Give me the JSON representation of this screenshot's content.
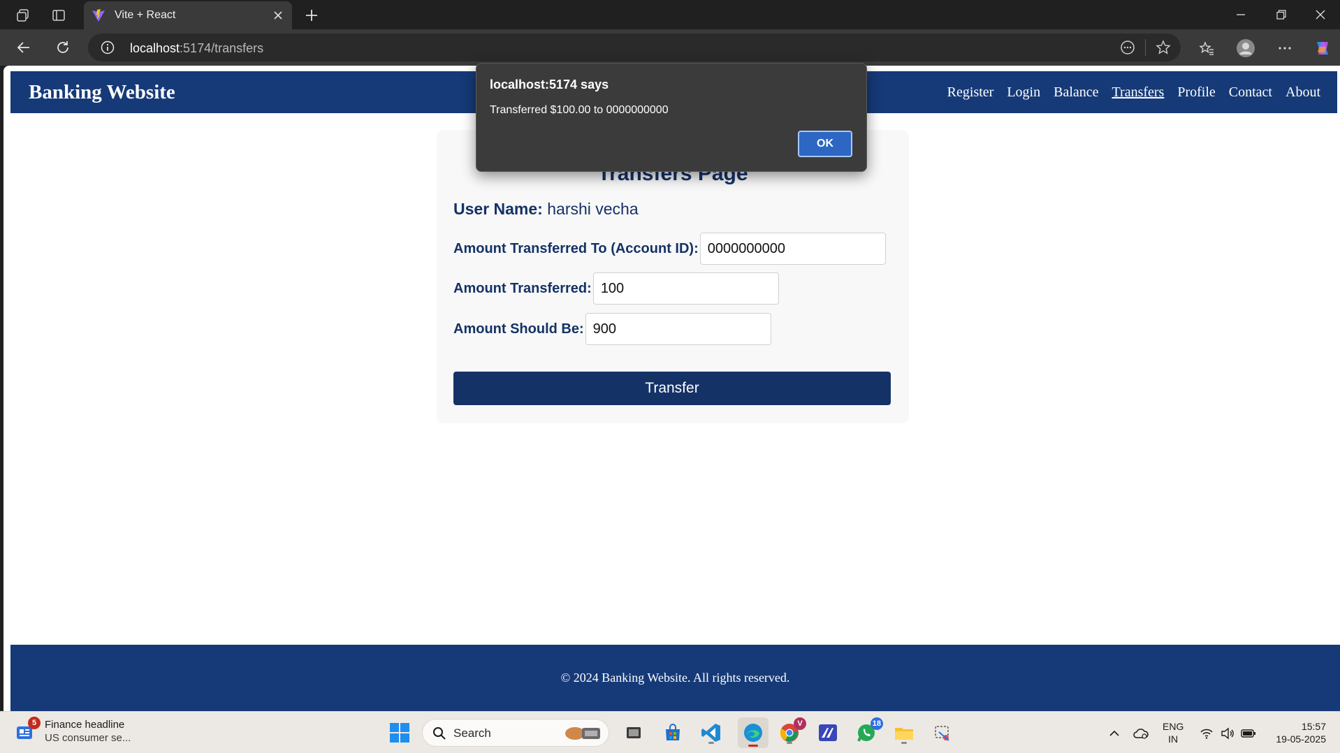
{
  "browser": {
    "tab_title": "Vite + React",
    "url_host": "localhost",
    "url_path": ":5174/transfers"
  },
  "site": {
    "title": "Banking Website",
    "nav": [
      {
        "label": "Register"
      },
      {
        "label": "Login"
      },
      {
        "label": "Balance"
      },
      {
        "label": "Transfers",
        "active": true
      },
      {
        "label": "Profile"
      },
      {
        "label": "Contact"
      },
      {
        "label": "About"
      }
    ],
    "footer": "© 2024 Banking Website. All rights reserved."
  },
  "transfers": {
    "heading": "Transfers Page",
    "user_label": "User Name:",
    "user_name": "harshi vecha",
    "account_label": "Amount Transferred To (Account ID):",
    "account_value": "0000000000",
    "amount_label": "Amount Transferred:",
    "amount_value": "100",
    "should_be_label": "Amount Should Be:",
    "should_be_value": "900",
    "button_label": "Transfer"
  },
  "dialog": {
    "title": "localhost:5174 says",
    "message": "Transferred $100.00 to 0000000000",
    "ok_label": "OK"
  },
  "taskbar": {
    "news_badge": "5",
    "news_title": "Finance headline",
    "news_subtitle": "US consumer se...",
    "search_placeholder": "Search",
    "whatsapp_badge": "18",
    "chrome_badge": "V",
    "lang_line1": "ENG",
    "lang_line2": "IN",
    "time": "15:57",
    "date": "19-05-2025"
  },
  "colors": {
    "navy": "#163a78",
    "heading": "#143266",
    "dialog_bg": "#3b3b3b",
    "ok_button": "#2d67c3"
  }
}
